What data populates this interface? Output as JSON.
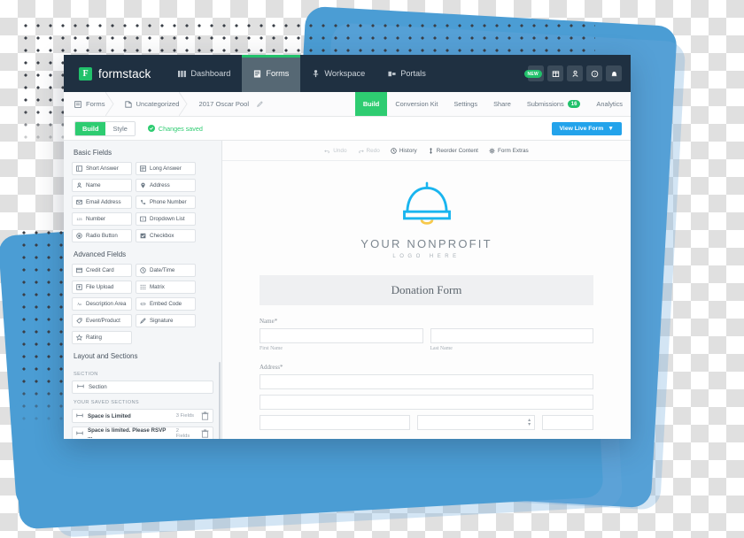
{
  "brand": {
    "name": "formstack",
    "mark": "F"
  },
  "topnav": {
    "items": [
      {
        "label": "Dashboard",
        "icon": "dashboard-icon",
        "active": false
      },
      {
        "label": "Forms",
        "icon": "forms-icon",
        "active": true
      },
      {
        "label": "Workspace",
        "icon": "workspace-icon",
        "active": false
      },
      {
        "label": "Portals",
        "icon": "portals-icon",
        "active": false
      }
    ],
    "new_badge": "NEW",
    "icons": [
      {
        "name": "apps-grid-icon"
      },
      {
        "name": "store-icon"
      },
      {
        "name": "user-icon"
      },
      {
        "name": "help-icon"
      },
      {
        "name": "bell-icon"
      }
    ]
  },
  "breadcrumb": {
    "items": [
      {
        "label": "Forms",
        "icon": "list-icon"
      },
      {
        "label": "Uncategorized",
        "icon": "folder-icon"
      },
      {
        "label": "2017 Oscar Pool",
        "icon": "none"
      }
    ],
    "edit_icon": "pencil-icon"
  },
  "subtabs": [
    {
      "label": "Build",
      "active": true
    },
    {
      "label": "Conversion Kit",
      "active": false
    },
    {
      "label": "Settings",
      "active": false
    },
    {
      "label": "Share",
      "active": false
    },
    {
      "label": "Submissions",
      "active": false,
      "count": "16"
    },
    {
      "label": "Analytics",
      "active": false
    }
  ],
  "buildbar": {
    "segment": [
      {
        "label": "Build",
        "active": true
      },
      {
        "label": "Style",
        "active": false
      }
    ],
    "status": "Changes saved",
    "status_icon": "check-circle-icon",
    "live_button": "View Live Form",
    "live_caret": "▼"
  },
  "sidebar": {
    "basic_title": "Basic Fields",
    "basic_fields": [
      {
        "label": "Short Answer",
        "icon": "short-answer-icon"
      },
      {
        "label": "Long Answer",
        "icon": "long-answer-icon"
      },
      {
        "label": "Name",
        "icon": "person-icon"
      },
      {
        "label": "Address",
        "icon": "map-pin-icon"
      },
      {
        "label": "Email Address",
        "icon": "envelope-icon"
      },
      {
        "label": "Phone Number",
        "icon": "phone-icon"
      },
      {
        "label": "Number",
        "icon": "number-icon"
      },
      {
        "label": "Dropdown List",
        "icon": "dropdown-icon"
      },
      {
        "label": "Radio Button",
        "icon": "radio-icon"
      },
      {
        "label": "Checkbox",
        "icon": "checkbox-icon"
      }
    ],
    "advanced_title": "Advanced Fields",
    "advanced_fields": [
      {
        "label": "Credit Card",
        "icon": "credit-card-icon"
      },
      {
        "label": "Date/Time",
        "icon": "clock-icon"
      },
      {
        "label": "File Upload",
        "icon": "upload-icon"
      },
      {
        "label": "Matrix",
        "icon": "matrix-icon"
      },
      {
        "label": "Description Area",
        "icon": "text-icon"
      },
      {
        "label": "Embed Code",
        "icon": "code-icon"
      },
      {
        "label": "Event/Product",
        "icon": "tag-icon"
      },
      {
        "label": "Signature",
        "icon": "signature-icon"
      },
      {
        "label": "Rating",
        "icon": "star-icon"
      }
    ],
    "layout_title": "Layout and Sections",
    "section_label": "SECTION",
    "section_item": {
      "label": "Section",
      "icon": "section-icon"
    },
    "saved_label": "YOUR SAVED SECTIONS",
    "saved_sections": [
      {
        "label": "Space is Limited",
        "count": "3 Fields",
        "icon": "section-icon",
        "delete_icon": "trash-icon"
      },
      {
        "label": "Space is limited. Please RSVP ...",
        "count": "2 Fields",
        "icon": "section-icon",
        "delete_icon": "trash-icon"
      }
    ]
  },
  "canvas": {
    "tools": [
      {
        "label": "Undo",
        "icon": "undo-icon",
        "disabled": true
      },
      {
        "label": "Redo",
        "icon": "redo-icon",
        "disabled": true
      },
      {
        "label": "History",
        "icon": "history-icon",
        "disabled": false
      },
      {
        "label": "Reorder Content",
        "icon": "reorder-icon",
        "disabled": false
      },
      {
        "label": "Form Extras",
        "icon": "gear-icon",
        "disabled": false
      }
    ],
    "logo": {
      "icon": "cloche-bell-logo-icon",
      "title": "YOUR NONPROFIT",
      "subtitle": "LOGO HERE",
      "color_primary": "#19b5ef",
      "color_accent": "#f7c94b"
    },
    "form_title": "Donation Form",
    "fields": [
      {
        "label": "Name",
        "required": "*",
        "sublabels": [
          "First Name",
          "Last Name"
        ]
      },
      {
        "label": "Address",
        "required": "*",
        "sublabels": []
      }
    ]
  },
  "colors": {
    "nav_bg": "#1f3041",
    "green": "#2ecc71",
    "blue": "#23a3eb",
    "card_blue": "#4b9dd4"
  }
}
